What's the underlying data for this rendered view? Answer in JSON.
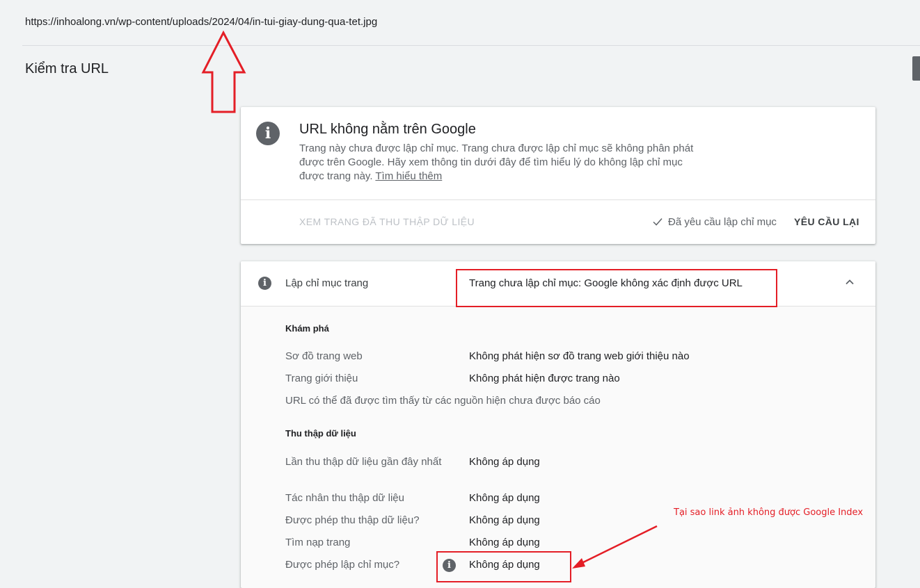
{
  "header": {
    "url": "https://inhoalong.vn/wp-content/uploads/2024/04/in-tui-giay-dung-qua-tet.jpg",
    "page_title": "Kiểm tra URL"
  },
  "status_card": {
    "title": "URL không nằm trên Google",
    "description": "Trang này chưa được lập chỉ mục. Trang chưa được lập chỉ mục sẽ không phân phát được trên Google. Hãy xem thông tin dưới đây để tìm hiểu lý do không lập chỉ mục được trang này.",
    "learn_more": "Tìm hiểu thêm",
    "view_crawled_label": "XEM TRANG ĐÃ THU THẬP DỮ LIỆU",
    "requested_label": "Đã yêu cầu lập chỉ mục",
    "request_again_label": "YÊU CẦU LẠI"
  },
  "indexing_card": {
    "label": "Lập chỉ mục trang",
    "value": "Trang chưa lập chỉ mục: Google không xác định được URL",
    "discovery": {
      "title": "Khám phá",
      "sitemap_label": "Sơ đồ trang web",
      "sitemap_value": "Không phát hiện sơ đồ trang web giới thiệu nào",
      "referring_label": "Trang giới thiệu",
      "referring_value": "Không phát hiện được trang nào",
      "note": "URL có thể đã được tìm thấy từ các nguồn hiện chưa được báo cáo"
    },
    "crawl": {
      "title": "Thu thập dữ liệu",
      "last_crawl_label": "Lần thu thập dữ liệu gần đây nhất",
      "last_crawl_value": "Không áp dụng",
      "crawled_as_label": "Tác nhân thu thập dữ liệu",
      "crawled_as_value": "Không áp dụng",
      "crawl_allowed_label": "Được phép thu thập dữ liệu?",
      "crawl_allowed_value": "Không áp dụng",
      "page_fetch_label": "Tìm nạp trang",
      "page_fetch_value": "Không áp dụng",
      "indexing_allowed_label": "Được phép lập chỉ mục?",
      "indexing_allowed_value": "Không áp dụng"
    }
  },
  "annotation": {
    "text": "Tại sao link ảnh không được Google Index",
    "color": "#e41e26"
  }
}
